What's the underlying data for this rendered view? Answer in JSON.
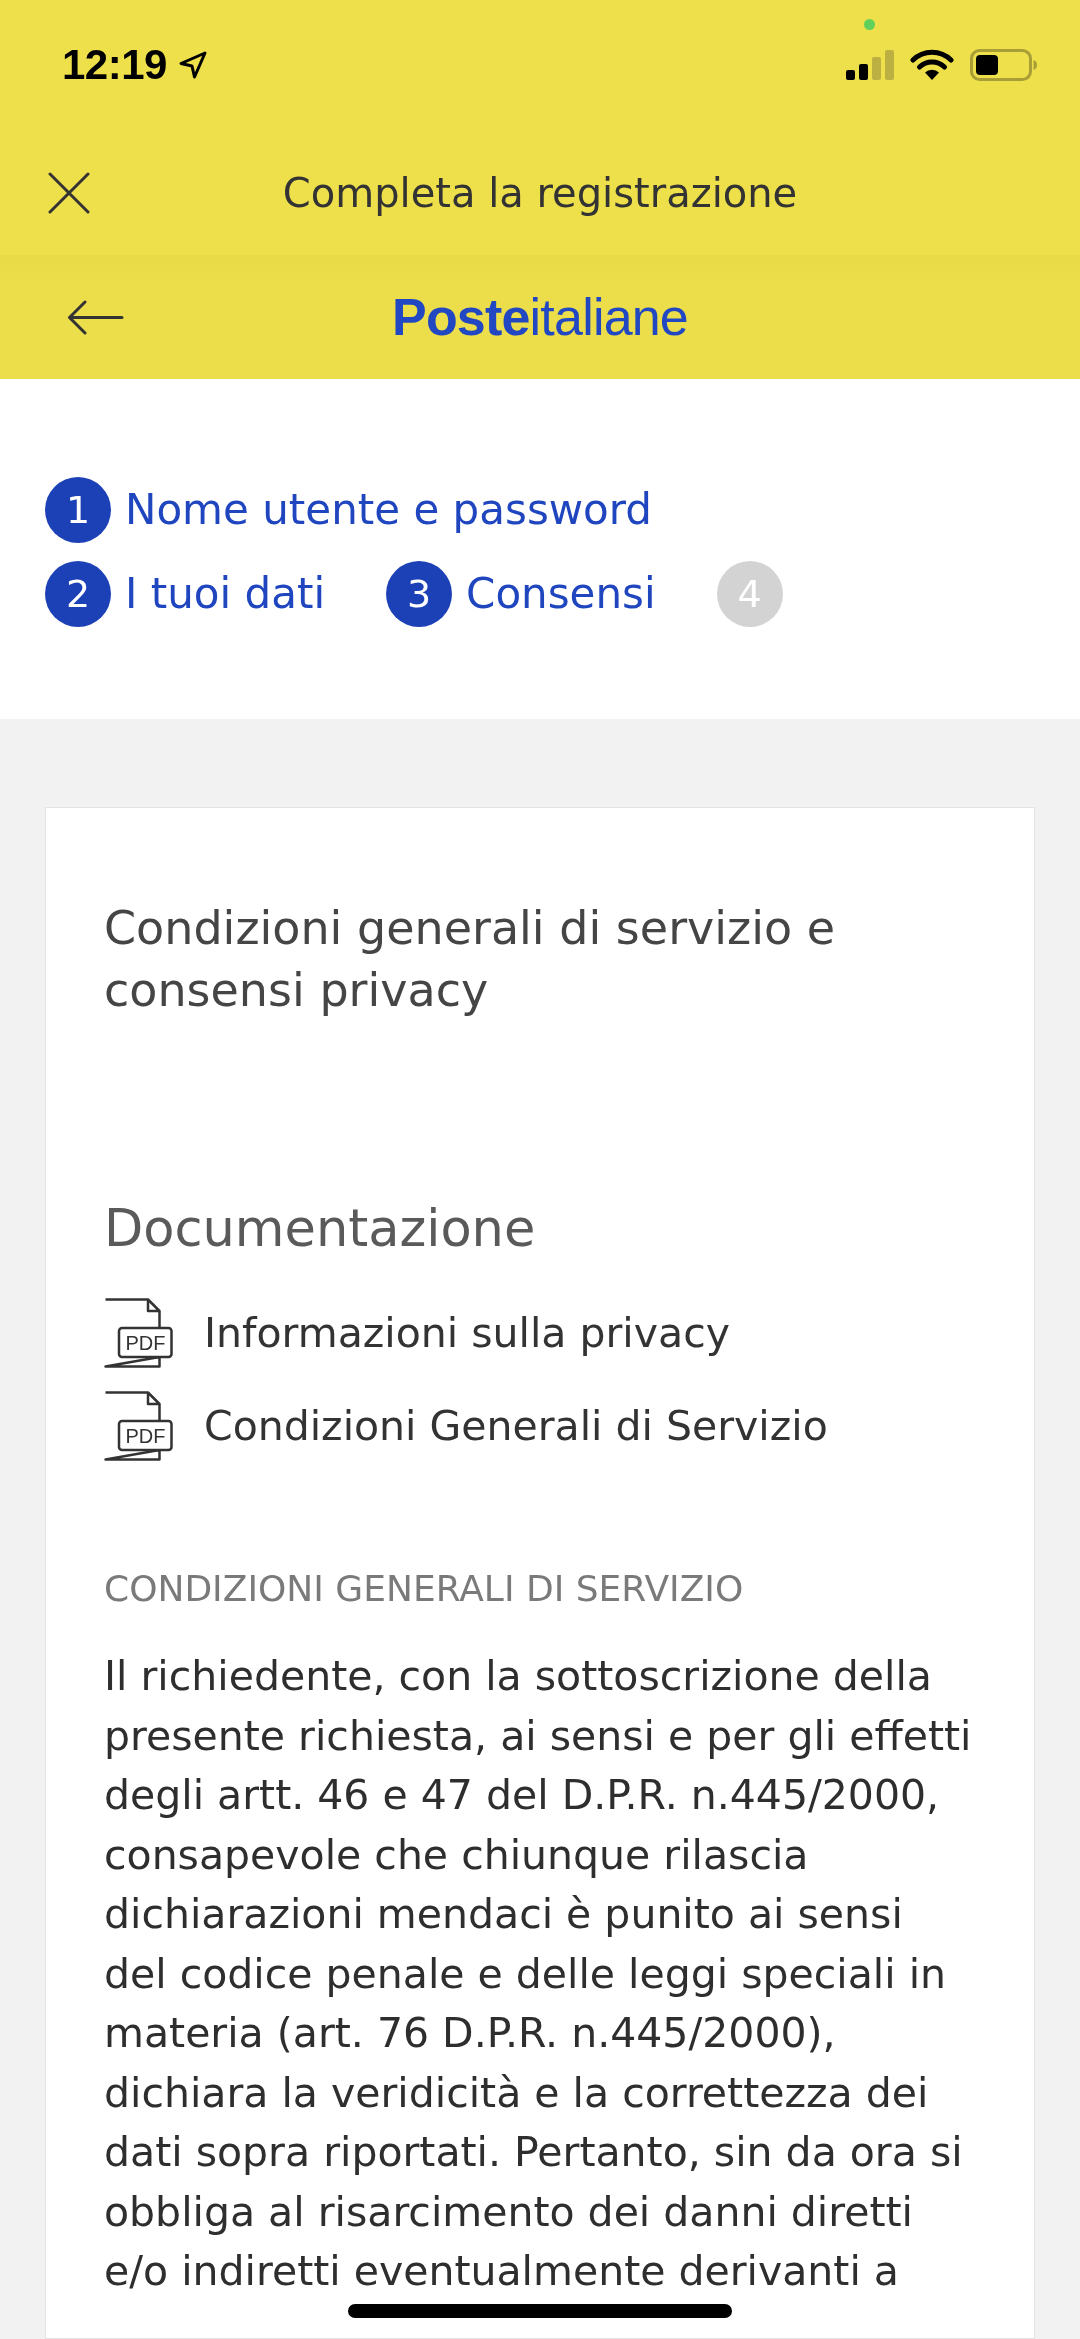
{
  "status_bar": {
    "time": "12:19"
  },
  "header": {
    "title": "Completa la registrazione",
    "logo": "**Poste**italiane"
  },
  "steps": [
    {
      "number": "1",
      "label": "Nome utente e password",
      "active": true
    },
    {
      "number": "2",
      "label": "I tuoi dati",
      "active": true
    },
    {
      "number": "3",
      "label": "Consensi",
      "active": true
    },
    {
      "number": "4",
      "active": false
    }
  ],
  "card": {
    "title": "Condizioni generali di servizio e consensi privacy",
    "documents_heading": "Documentazione",
    "documents": [
      {
        "badge": "PDF",
        "label": "Informazioni sulla privacy"
      },
      {
        "badge": "PDF",
        "label": "Condizioni Generali di Servizio"
      }
    ],
    "section_heading": "CONDIZIONI GENERALI DI SERVIZIO",
    "body": "Il richiedente, con la sottoscrizione della presente richiesta, ai sensi e per gli effetti degli artt. 46 e 47 del D.P.R. n.445/2000, consapevole che chiunque rilascia dichiarazioni mendaci è punito ai sensi del codice penale e delle leggi speciali in materia (art. 76 D.P.R. n.445/2000), dichiara la veridicità e la correttezza dei dati sopra riportati. Pertanto, sin da ora si obbliga al risarcimento dei danni diretti e/o indiretti eventualmente derivanti a"
  }
}
